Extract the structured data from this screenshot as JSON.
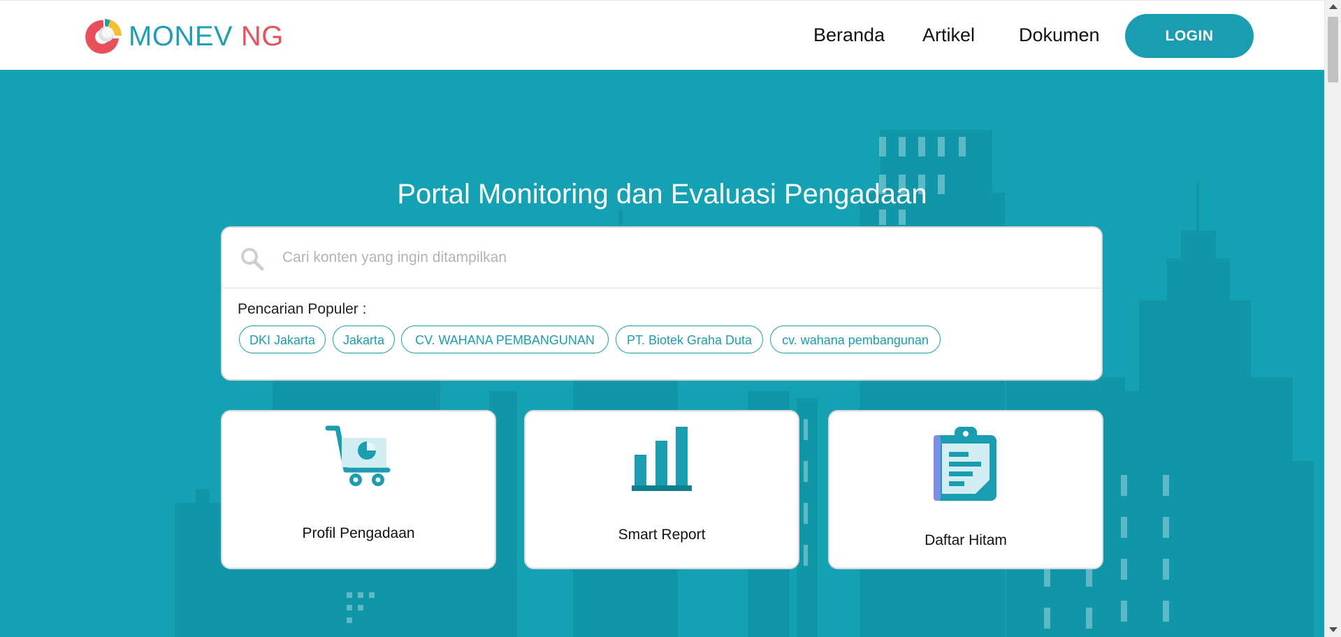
{
  "header": {
    "logo_part1": "MONEV",
    "logo_part2": "NG",
    "nav": [
      "Beranda",
      "Artikel",
      "Dokumen"
    ],
    "login_label": "LOGIN"
  },
  "hero": {
    "title": "Portal Monitoring dan Evaluasi Pengadaan",
    "search": {
      "placeholder": "Cari konten yang ingin ditampilkan",
      "popular_label": "Pencarian Populer :",
      "tags": [
        "DKI Jakarta",
        "Jakarta",
        "CV. WAHANA PEMBANGUNAN",
        "PT. Biotek Graha Duta",
        "cv. wahana pembangunan"
      ]
    },
    "cards": [
      {
        "label": "Profil Pengadaan",
        "icon": "shopping-cart-icon"
      },
      {
        "label": "Smart Report",
        "icon": "bar-chart-icon"
      },
      {
        "label": "Daftar Hitam",
        "icon": "clipboard-icon"
      }
    ]
  },
  "colors": {
    "brand_teal": "#1a9db0",
    "brand_red": "#e8505b",
    "hero_bg": "#14a1b3",
    "skyline": "#0f8ea0"
  }
}
